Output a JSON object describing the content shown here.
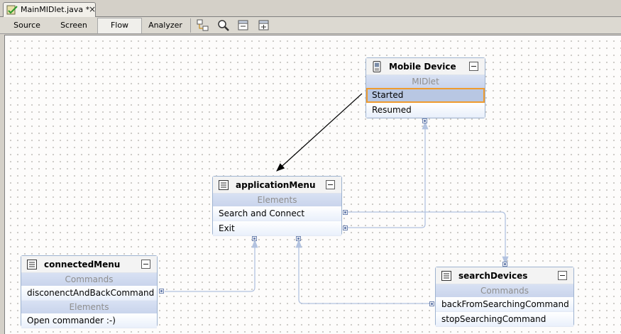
{
  "file_tab": {
    "title": "MainMIDlet.java *",
    "close_glyph": "×",
    "icon": "midlet-file-icon"
  },
  "view_tabs": {
    "source": "Source",
    "screen": "Screen",
    "flow": "Flow",
    "analyzer": "Analyzer",
    "active": "Flow"
  },
  "toolbar": {
    "icons": [
      "layout-icon",
      "zoom-icon",
      "collapse-all-icon",
      "expand-all-icon"
    ]
  },
  "nodes": {
    "mobile_device": {
      "title": "Mobile Device",
      "section": "MIDlet",
      "rows": [
        "Started",
        "Resumed"
      ],
      "selected_row": "Started"
    },
    "application_menu": {
      "title": "applicationMenu",
      "section": "Elements",
      "rows": [
        "Search and Connect",
        "Exit"
      ]
    },
    "connected_menu": {
      "title": "connectedMenu",
      "section_commands": "Commands",
      "command_rows": [
        "disconenctAndBackCommand"
      ],
      "section_elements": "Elements",
      "element_rows": [
        "Open commander :-)"
      ]
    },
    "search_devices": {
      "title": "searchDevices",
      "section": "Commands",
      "rows": [
        "backFromSearchingCommand",
        "stopSearchingCommand"
      ]
    }
  },
  "colors": {
    "selection_border": "#ef9b2e",
    "selection_fill": "#b8c7e3",
    "node_border": "#9eb3d0",
    "wire": "#b3c3e0",
    "start_arrow": "#000000"
  }
}
